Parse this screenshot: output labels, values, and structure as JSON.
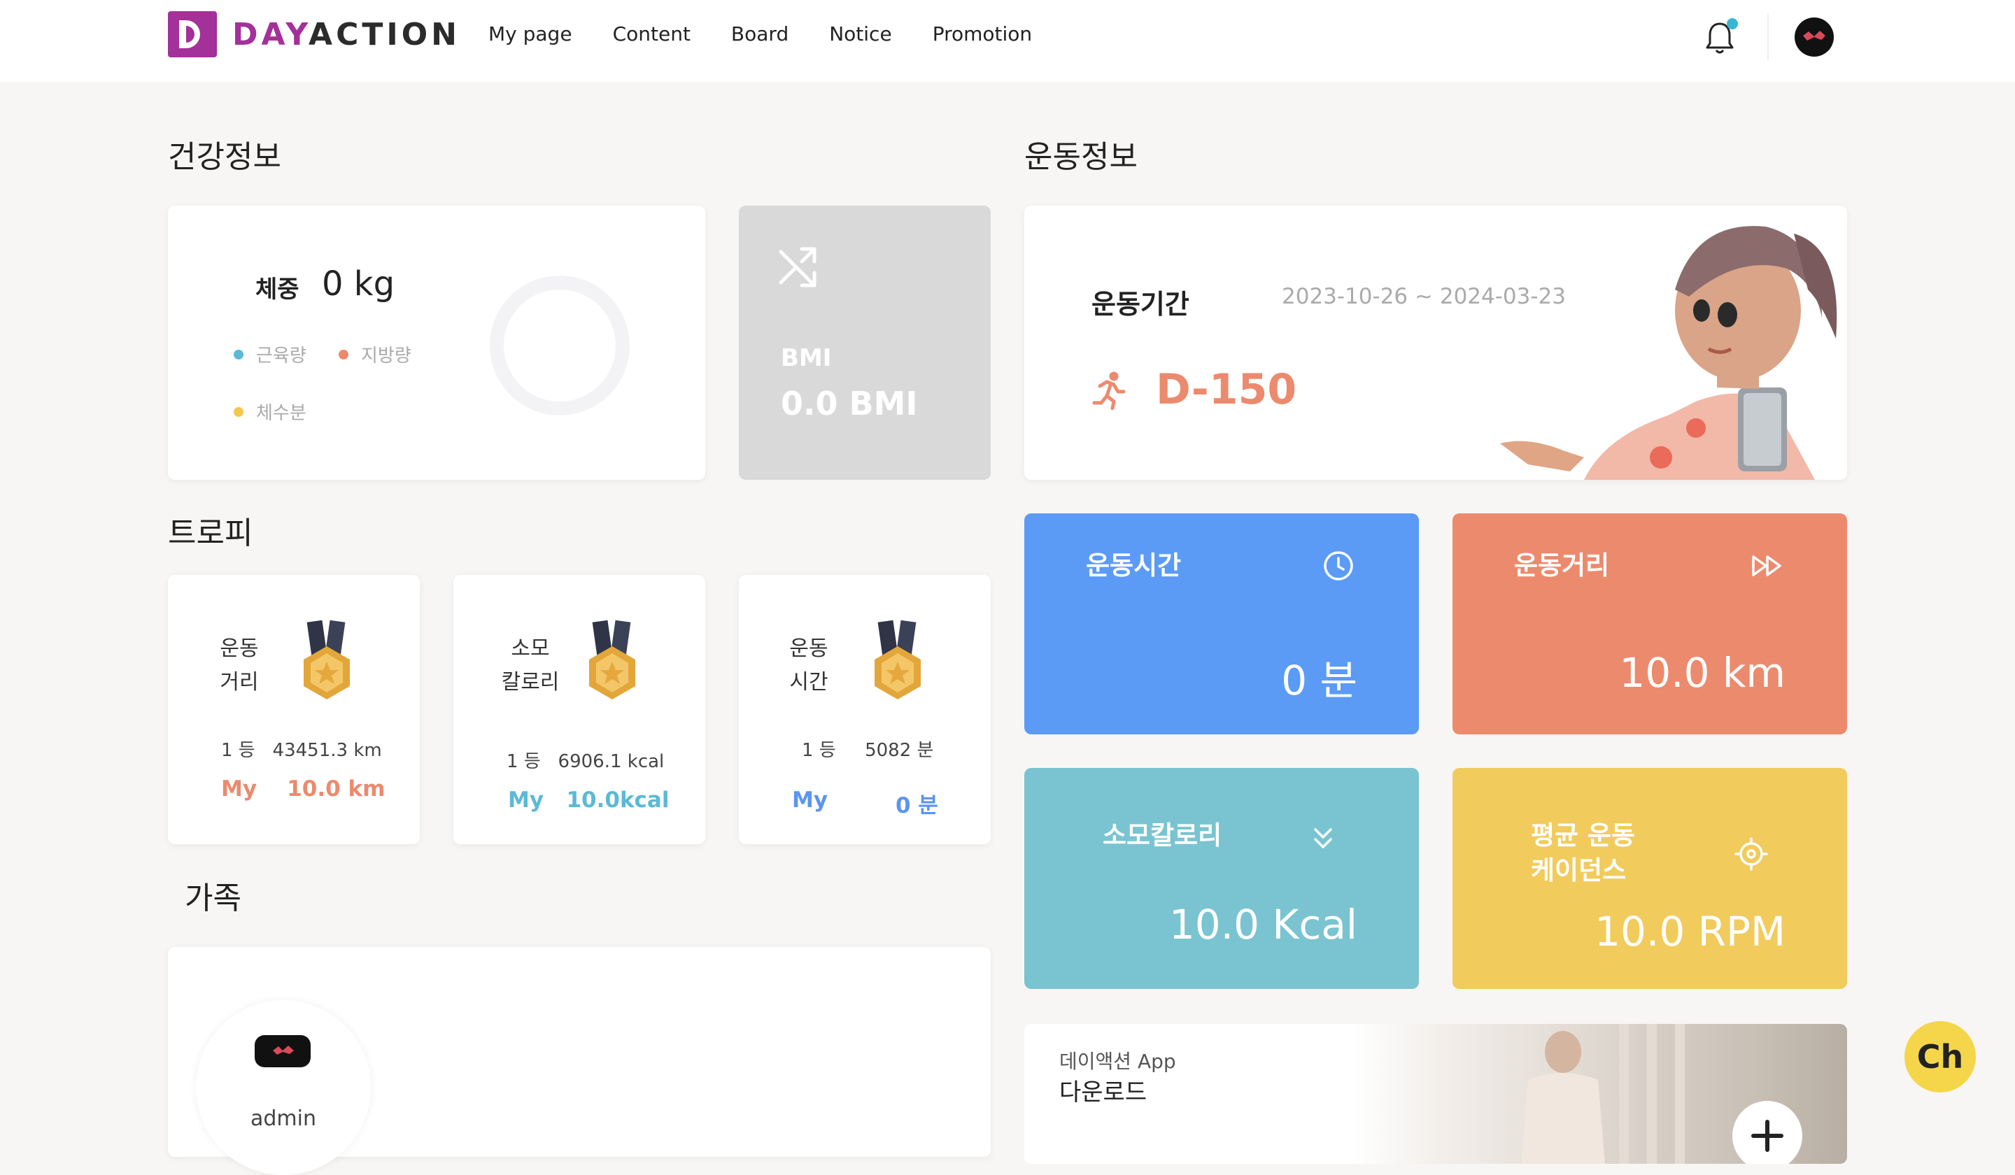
{
  "header": {
    "logo": {
      "day": "DAY",
      "action": "ACTION"
    },
    "nav": [
      "My page",
      "Content",
      "Board",
      "Notice",
      "Promotion"
    ]
  },
  "health": {
    "title": "건강정보",
    "weight_label": "체중",
    "weight_value": "0 kg",
    "legend": [
      {
        "label": "근육량",
        "color": "#5bbad5"
      },
      {
        "label": "지방량",
        "color": "#ec8a6d"
      },
      {
        "label": "체수분",
        "color": "#f2c94c"
      }
    ],
    "bmi_label": "BMI",
    "bmi_value": "0.0 BMI"
  },
  "trophy": {
    "title": "트로피",
    "cards": [
      {
        "title": "운동\n거리",
        "rank": "1 등",
        "rank_value": "43451.3 km",
        "my_label": "My",
        "my_value": "10.0 km",
        "color": "#ec8a6d"
      },
      {
        "title": "소모\n칼로리",
        "rank": "1 등",
        "rank_value": "6906.1 kcal",
        "my_label": "My",
        "my_value": "10.0kcal",
        "color": "#5bbad5"
      },
      {
        "title": "운동\n시간",
        "rank": "1 등",
        "rank_value": "5082 분",
        "my_label": "My",
        "my_value": "0 분",
        "color": "#5b95f0"
      }
    ]
  },
  "family": {
    "title": "가족",
    "member_name": "admin"
  },
  "exercise": {
    "title": "운동정보",
    "period_label": "운동기간",
    "period_range": "2023-10-26 ~ 2024-03-23",
    "dday": "D-150",
    "stats": [
      {
        "title": "운동시간",
        "value": "0 분",
        "color": "#5b9bf6",
        "icon": "clock-icon"
      },
      {
        "title": "운동거리",
        "value": "10.0 km",
        "color": "#ec8a6d",
        "icon": "fast-forward-icon"
      },
      {
        "title": "소모칼로리",
        "value": "10.0 Kcal",
        "color": "#79c4d0",
        "icon": "double-chevron-down-icon"
      },
      {
        "title": "평균 운동\n케이던스",
        "value": "10.0 RPM",
        "color": "#f1cb5c",
        "icon": "target-icon"
      }
    ]
  },
  "app_download": {
    "subtitle": "데이액션 App",
    "title": "다운로드"
  },
  "chat": {
    "label": "Ch"
  }
}
